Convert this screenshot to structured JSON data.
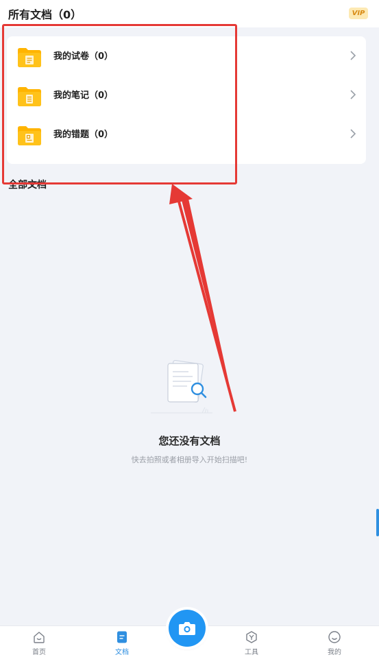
{
  "header": {
    "title": "所有文档（0）",
    "vip_badge": "VIP"
  },
  "folders": [
    {
      "label": "我的试卷（0）",
      "icon": "exam-folder-icon"
    },
    {
      "label": "我的笔记（0）",
      "icon": "notes-folder-icon"
    },
    {
      "label": "我的错题（0）",
      "icon": "mistakes-folder-icon"
    }
  ],
  "section": {
    "title": "全部文档"
  },
  "empty_state": {
    "title": "您还没有文档",
    "hint": "快去拍照或者相册导入开始扫描吧!",
    "icon": "empty-document-search-icon"
  },
  "tabs": [
    {
      "label": "首页",
      "icon": "home-icon",
      "active": false
    },
    {
      "label": "文档",
      "icon": "document-icon",
      "active": true
    },
    {
      "label": "工具",
      "icon": "tools-icon",
      "active": false
    },
    {
      "label": "我的",
      "icon": "profile-icon",
      "active": false
    }
  ],
  "camera_button": {
    "icon": "camera-icon"
  },
  "colors": {
    "accent": "#2196f3",
    "folder": "#ffb400",
    "annotation": "#e53935",
    "background": "#f1f3f8"
  }
}
